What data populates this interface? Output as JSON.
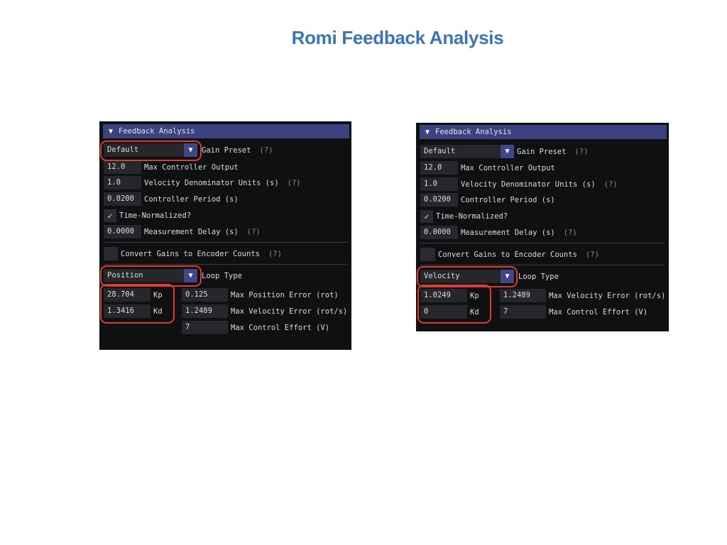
{
  "slide": {
    "title": "Romi Feedback Analysis"
  },
  "panels": {
    "left": {
      "header": "Feedback Analysis",
      "gain_preset": {
        "value": "Default",
        "label": "Gain Preset",
        "help": "(?)"
      },
      "max_controller_output": {
        "value": "12.0",
        "label": "Max Controller Output"
      },
      "velocity_denominator": {
        "value": "1.0",
        "label": "Velocity Denominator Units (s)",
        "help": "(?)"
      },
      "controller_period": {
        "value": "0.0200",
        "label": "Controller Period (s)"
      },
      "time_normalized": {
        "label": "Time-Normalized?",
        "checked": true
      },
      "measurement_delay": {
        "value": "0.0000",
        "label": "Measurement Delay (s)",
        "help": "(?)"
      },
      "convert_gains": {
        "label": "Convert Gains to Encoder Counts",
        "help": "(?)",
        "checked": false
      },
      "loop_type": {
        "value": "Position",
        "label": "Loop Type"
      },
      "gains": [
        {
          "value": "28.704",
          "label": "Kp"
        },
        {
          "value": "1.3416",
          "label": "Kd"
        }
      ],
      "limits": [
        {
          "value": "0.125",
          "label": "Max Position Error (rot)"
        },
        {
          "value": "1.2489",
          "label": "Max Velocity Error (rot/s)"
        },
        {
          "value": "7",
          "label": "Max Control Effort (V)"
        }
      ]
    },
    "right": {
      "header": "Feedback Analysis",
      "gain_preset": {
        "value": "Default",
        "label": "Gain Preset",
        "help": "(?)"
      },
      "max_controller_output": {
        "value": "12.0",
        "label": "Max Controller Output"
      },
      "velocity_denominator": {
        "value": "1.0",
        "label": "Velocity Denominator Units (s)",
        "help": "(?)"
      },
      "controller_period": {
        "value": "0.0200",
        "label": "Controller Period (s)"
      },
      "time_normalized": {
        "label": "Time-Normalized?",
        "checked": true
      },
      "measurement_delay": {
        "value": "0.0000",
        "label": "Measurement Delay (s)",
        "help": "(?)"
      },
      "convert_gains": {
        "label": "Convert Gains to Encoder Counts",
        "help": "(?)",
        "checked": false
      },
      "loop_type": {
        "value": "Velocity",
        "label": "Loop Type"
      },
      "gains": [
        {
          "value": "1.0249",
          "label": "Kp"
        },
        {
          "value": "0",
          "label": "Kd"
        }
      ],
      "limits": [
        {
          "value": "1.2489",
          "label": "Max Velocity Error (rot/s)"
        },
        {
          "value": "7",
          "label": "Max Control Effort (V)"
        }
      ]
    }
  },
  "icons": {
    "collapse": "▼",
    "dropdown": "▼",
    "check": "✓"
  },
  "colors": {
    "title": "#3a75b5",
    "panel_bg": "#0f1012",
    "header_bg": "#3a4280",
    "field_bg": "#26272b",
    "dropdown_btn": "#3f4788",
    "highlight": "#e03b2f"
  }
}
